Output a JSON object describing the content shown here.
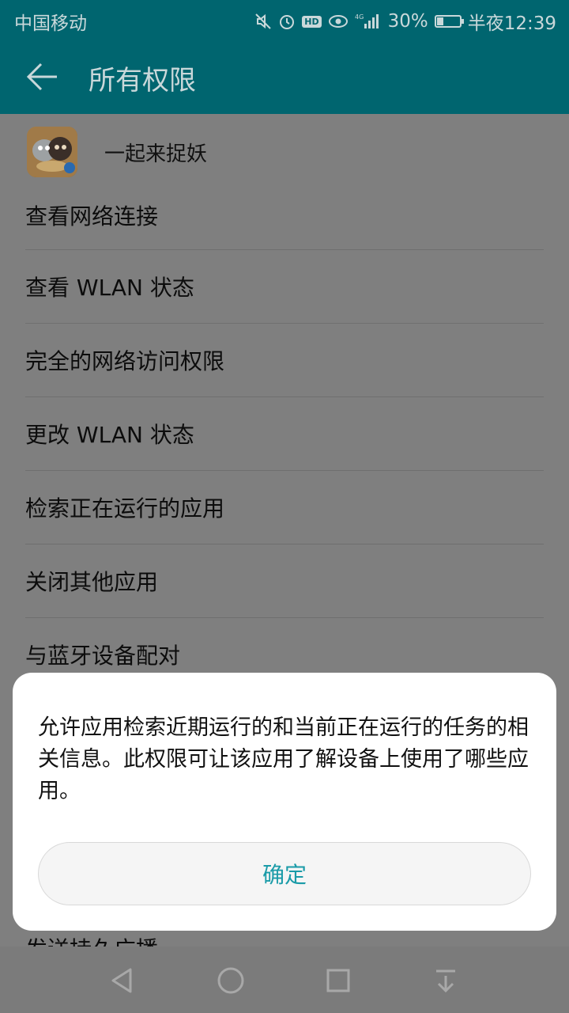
{
  "status_bar": {
    "carrier": "中国移动",
    "network": "4G",
    "battery_percent": "30%",
    "battery_level": 0.3,
    "time": "半夜12:39",
    "icons": [
      "mute-icon",
      "alarm-icon",
      "hd-icon",
      "eye-comfort-icon",
      "signal-icon",
      "battery-icon"
    ]
  },
  "toolbar": {
    "title": "所有权限",
    "back_icon": "back-arrow-icon"
  },
  "app": {
    "name": "一起来捉妖",
    "icon": "app-icon"
  },
  "permissions": [
    "查看网络连接",
    "查看 WLAN 状态",
    "完全的网络访问权限",
    "更改 WLAN 状态",
    "检索正在运行的应用",
    "关闭其他应用",
    "与蓝牙设备配对"
  ],
  "partial_item": "发送持久广播",
  "dialog": {
    "message": "允许应用检索近期运行的和当前正在运行的任务的相关信息。此权限可让该应用了解设备上使用了哪些应用。",
    "ok_label": "确定"
  },
  "nav_bar": {
    "icons": [
      "back-triangle-icon",
      "home-circle-icon",
      "recents-square-icon",
      "notification-pull-icon"
    ]
  },
  "colors": {
    "toolbar": "#00656f",
    "accent": "#1a9ba8",
    "scrim": "#7f7f7f"
  }
}
